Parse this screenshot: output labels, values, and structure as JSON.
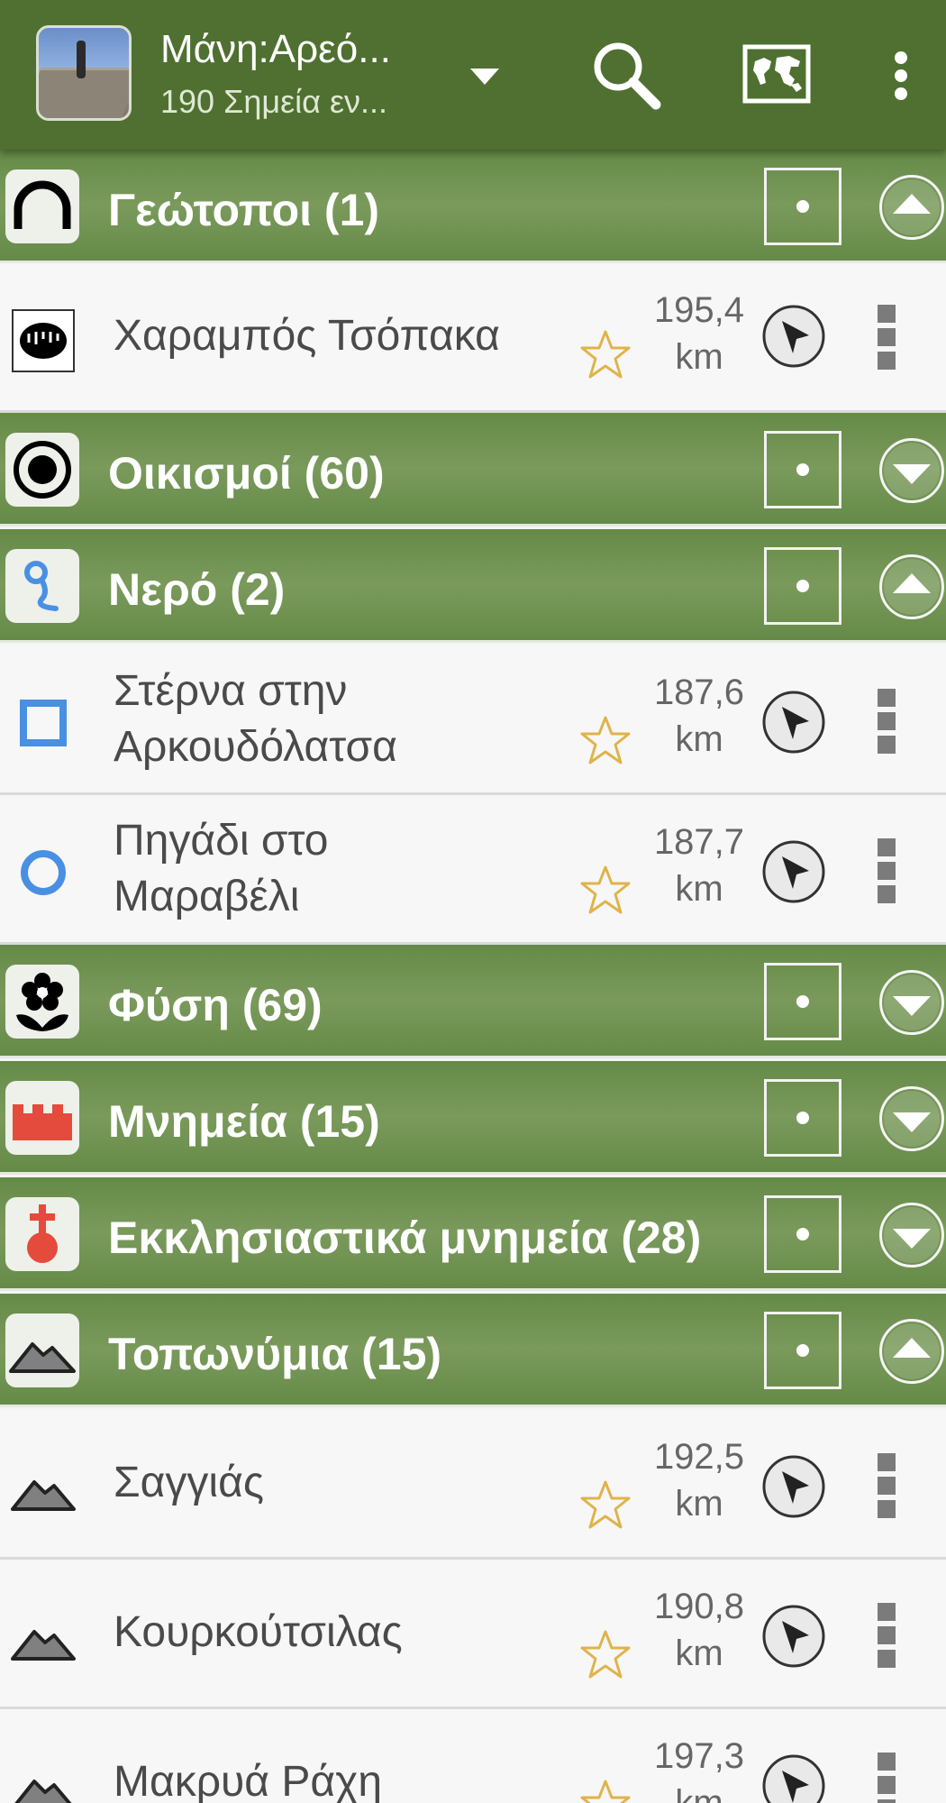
{
  "appbar": {
    "title": "Μάνη:Αρεό...",
    "subtitle": "190 Σημεία εν...",
    "icons": [
      "photo-thumbnail",
      "dropdown-arrow-icon",
      "search-icon",
      "map-icon",
      "more-vert-icon"
    ]
  },
  "colors": {
    "appbar": "#4f7030",
    "header_green": "#6f9252",
    "accent_blue": "#4a90e2",
    "star_gold": "#e0b34a"
  },
  "groups": [
    {
      "label": "Γεώτοποι (1)",
      "icon": "geosite-icon",
      "expanded": true,
      "checked": true
    },
    {
      "label": "Οικισμοί (60)",
      "icon": "settlement-icon",
      "expanded": false,
      "checked": true
    },
    {
      "label": "Νερό (2)",
      "icon": "water-icon",
      "expanded": true,
      "checked": true
    },
    {
      "label": "Φύση (69)",
      "icon": "nature-icon",
      "expanded": false,
      "checked": true
    },
    {
      "label": "Μνημεία (15)",
      "icon": "monument-icon",
      "expanded": false,
      "checked": true
    },
    {
      "label": "Εκκλησιαστικά μνημεία (28)",
      "icon": "church-monument-icon",
      "expanded": false,
      "checked": true
    },
    {
      "label": "Τοπωνύμια (15)",
      "icon": "toponym-icon",
      "expanded": true,
      "checked": true
    }
  ],
  "items": [
    {
      "line1": "Χαραμπός Τσόπακα",
      "line2": "",
      "dist": "195,4",
      "unit": "km",
      "icon": "cave-icon"
    },
    {
      "line1": "Στέρνα στην",
      "line2": "Αρκουδόλατσα",
      "dist": "187,6",
      "unit": "km",
      "icon": "cistern-icon"
    },
    {
      "line1": "Πηγάδι στο",
      "line2": "Μαραβέλι",
      "dist": "187,7",
      "unit": "km",
      "icon": "well-icon"
    },
    {
      "line1": "Σαγγιάς",
      "line2": "",
      "dist": "192,5",
      "unit": "km",
      "icon": "mountain-icon"
    },
    {
      "line1": "Κουρκούτσιλας",
      "line2": "",
      "dist": "190,8",
      "unit": "km",
      "icon": "mountain-icon"
    },
    {
      "line1": "Μακρυά Ράχη",
      "line2": "",
      "dist": "197,3",
      "unit": "km",
      "icon": "mountain-icon"
    }
  ]
}
